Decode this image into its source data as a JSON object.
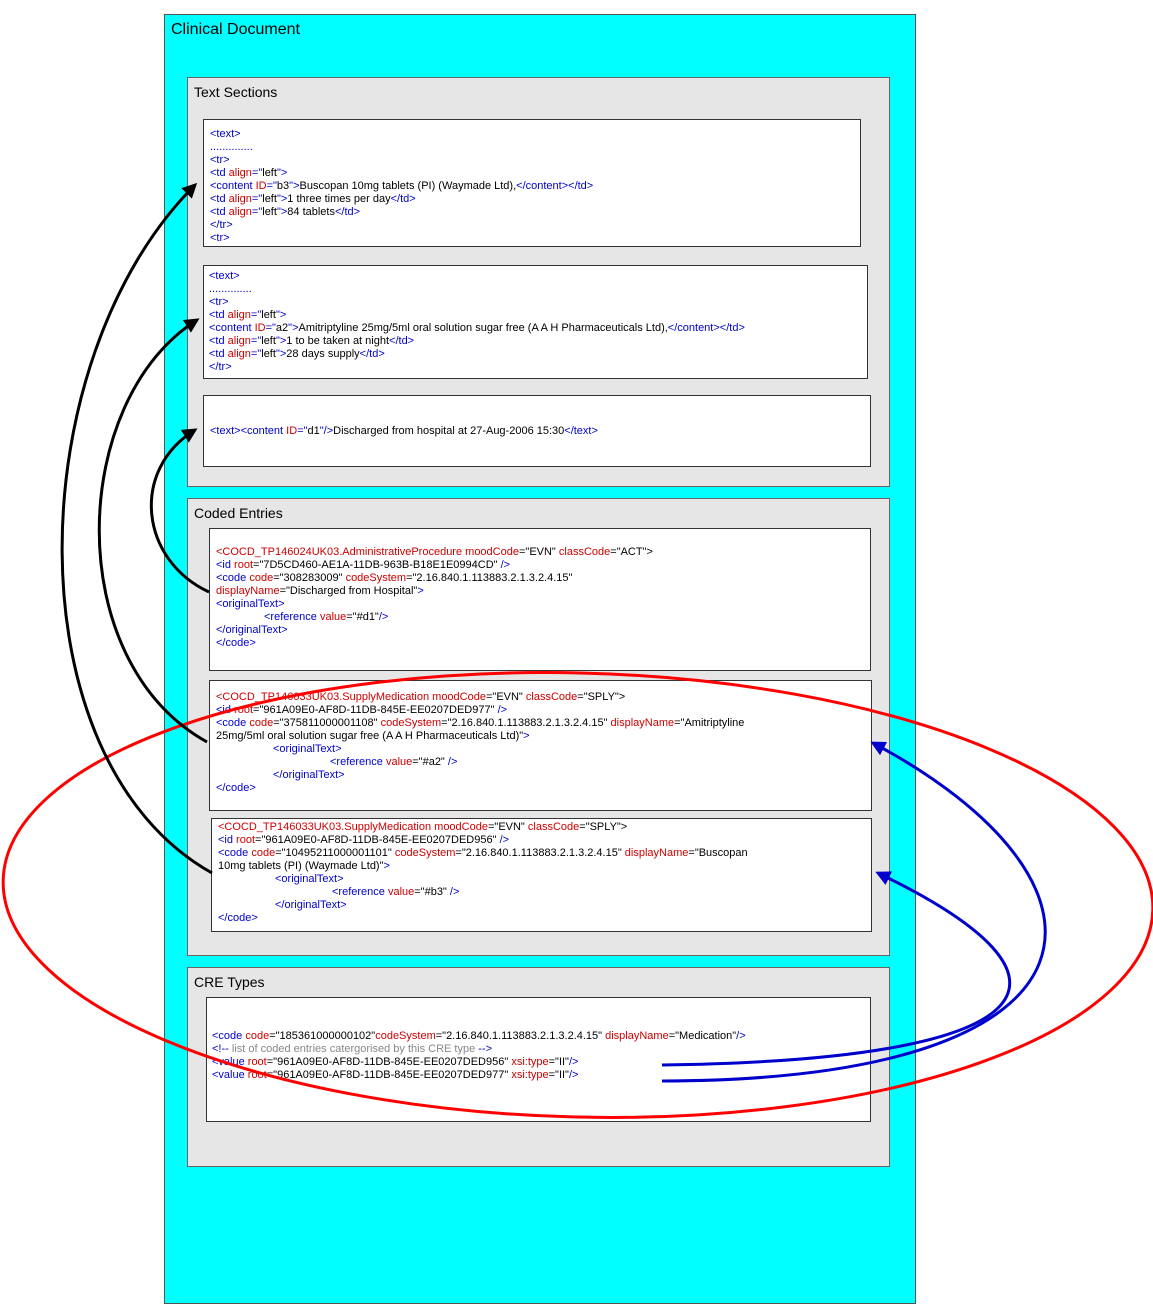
{
  "colors": {
    "document_bg": "#00ffff",
    "section_bg": "#e6e6e6",
    "tag_blue": "#0000cc",
    "attr_red": "#cc0000",
    "comment_gray": "#888888",
    "arrow_black": "#000000",
    "arrow_blue": "#0000cc",
    "ellipse_red": "#ff0000"
  },
  "document": {
    "title": "Clinical Document"
  },
  "text_sections": {
    "title": "Text Sections",
    "box1": {
      "l1": "<text>",
      "l2": "..............",
      "l3": "<tr>",
      "l4_tag": "<td ",
      "l4_attr": "align",
      "l4_eq": "=\"",
      "l4_val": "left",
      "l4_end": "\">",
      "l5_open": "<content ",
      "l5_attr": "ID",
      "l5_eq": "=\"",
      "l5_val": "b3",
      "l5_close": "\">",
      "l5_text": "Buscopan 10mg tablets (PI) (Waymade Ltd),",
      "l5_end": "</content></td>",
      "l6_open": "<td ",
      "l6_attr": "align",
      "l6_mid": "=\"",
      "l6_val": "left",
      "l6_close": "\">",
      "l6_text": "1 three times per day",
      "l6_end": "</td>",
      "l7_open": "<td ",
      "l7_attr": "align",
      "l7_mid": "=\"",
      "l7_val": "left",
      "l7_close": "\">",
      "l7_text": "84 tablets",
      "l7_end": "</td>",
      "l8": "</tr>",
      "l9": "<tr>"
    },
    "box2": {
      "l1": "<text>",
      "l2": "..............",
      "l3": "<tr>",
      "l4_tag": "<td ",
      "l4_attr": "align",
      "l4_eq": "=\"",
      "l4_val": "left",
      "l4_end": "\">",
      "l5_open": "<content ",
      "l5_attr": "ID",
      "l5_eq": "=\"",
      "l5_val": "a2",
      "l5_close": "\">",
      "l5_text": "Amitriptyline 25mg/5ml oral solution sugar free (A A H Pharmaceuticals Ltd),",
      "l5_end": "</content></td>",
      "l6_open": "<td ",
      "l6_attr": "align",
      "l6_mid": "=\"",
      "l6_val": "left",
      "l6_close": "\">",
      "l6_text": "1 to be taken at night",
      "l6_end": "</td>",
      "l7_open": "<td ",
      "l7_attr": "align",
      "l7_mid": "=\"",
      "l7_val": "left",
      "l7_close": "\">",
      "l7_text": "28 days supply",
      "l7_end": "</td>",
      "l8": "</tr>"
    },
    "box3": {
      "open": "<text><content ",
      "attr": "ID",
      "eq": "=\"",
      "val": "d1",
      "close": "\"/>",
      "text": "Discharged from hospital at 27-Aug-2006 15:30",
      "end": "</text>"
    }
  },
  "coded_entries": {
    "title": "Coded Entries",
    "entry1": {
      "l1_tag": "<COCD_TP146024UK03.AdministrativeProcedure ",
      "l1_a1": "moodCode",
      "l1_v1": "=\"EVN\" ",
      "l1_a2": "classCode",
      "l1_v2": "=\"ACT\">",
      "l2_tag": "<id ",
      "l2_a": "root",
      "l2_v": "=\"7D5CD460-AE1A-11DB-963B-B18E1E0994CD\" ",
      "l2_end": "/>",
      "l3_tag": "<code ",
      "l3_a1": "code",
      "l3_v1": "=\"308283009\" ",
      "l3_a2": "codeSystem",
      "l3_v2": "=\"2.16.840.1.113883.2.1.3.2.4.15\"",
      "l4_a": "displayName",
      "l4_v": "=\"Discharged from Hospital\"",
      "l4_end": ">",
      "l5": "<originalText>",
      "l6_tag": "<reference ",
      "l6_a": "value",
      "l6_v": "=\"#d1\"",
      "l6_end": "/>",
      "l7": "</originalText>",
      "l8": "</code>"
    },
    "entry2": {
      "l1_tag": "<COCD_TP146033UK03.SupplyMedication ",
      "l1_a1": "moodCode",
      "l1_v1": "=\"EVN\" ",
      "l1_a2": "classCode",
      "l1_v2": "=\"SPLY\">",
      "l2_tag": "<id ",
      "l2_a": "root",
      "l2_v": "=\"961A09E0-AF8D-11DB-845E-EE0207DED977\" ",
      "l2_end": "/>",
      "l3_tag": "<code ",
      "l3_a1": "code",
      "l3_v1": "=\"375811000001108\" ",
      "l3_a2": "codeSystem",
      "l3_v2": "=\"2.16.840.1.113883.2.1.3.2.4.15\" ",
      "l3_a3": "displayName",
      "l3_v3": "=\"Amitriptyline",
      "l4_v": "25mg/5ml oral solution sugar free (A A H Pharmaceuticals Ltd)\"",
      "l4_end": ">",
      "l5": "<originalText>",
      "l6_tag": "<reference ",
      "l6_a": "value",
      "l6_v": "=\"#a2\" ",
      "l6_end": "/>",
      "l7": "</originalText>",
      "l8": "</code>"
    },
    "entry3": {
      "l1_tag": "<COCD_TP146033UK03.SupplyMedication ",
      "l1_a1": "moodCode",
      "l1_v1": "=\"EVN\" ",
      "l1_a2": "classCode",
      "l1_v2": "=\"SPLY\">",
      "l2_tag": "<id ",
      "l2_a": "root",
      "l2_v": "=\"961A09E0-AF8D-11DB-845E-EE0207DED956\" ",
      "l2_end": "/>",
      "l3_tag": "<code ",
      "l3_a1": "code",
      "l3_v1": "=\"10495211000001101\" ",
      "l3_a2": "codeSystem",
      "l3_v2": "=\"2.16.840.1.113883.2.1.3.2.4.15\" ",
      "l3_a3": "displayName",
      "l3_v3": "=\"Buscopan",
      "l4_v": "10mg tablets (PI) (Waymade Ltd)\"",
      "l4_end": ">",
      "l5": "<originalText>",
      "l6_tag": "<reference ",
      "l6_a": "value",
      "l6_v": "=\"#b3\" ",
      "l6_end": "/>",
      "l7": "</originalText>",
      "l8": "</code>"
    }
  },
  "cre_types": {
    "title": "CRE Types",
    "l1_tag": "<code ",
    "l1_a1": "code",
    "l1_v1": "=\"185361000000102\"",
    "l1_a2": "codeSystem",
    "l1_v2": "=\"2.16.840.1.113883.2.1.3.2.4.15\" ",
    "l1_a3": "displayName",
    "l1_v3": "=\"Medication\"",
    "l1_end": "/>",
    "l2_open": "<!-- ",
    "l2_text": "list of coded entries catergorised by this CRE type ",
    "l2_close": "-->",
    "l3_tag": "<value ",
    "l3_a1": "root",
    "l3_v1": "=\"961A09E0-AF8D-11DB-845E-EE0207DED956\" ",
    "l3_a2": "xsi:type",
    "l3_v2": "=\"II\"",
    "l3_end": "/>",
    "l4_tag": "<value ",
    "l4_a1": "root",
    "l4_v1": "=\"961A09E0-AF8D-11DB-845E-EE0207DED977\" ",
    "l4_a2": "xsi:type",
    "l4_v2": "=\"II\"",
    "l4_end": "/>"
  }
}
